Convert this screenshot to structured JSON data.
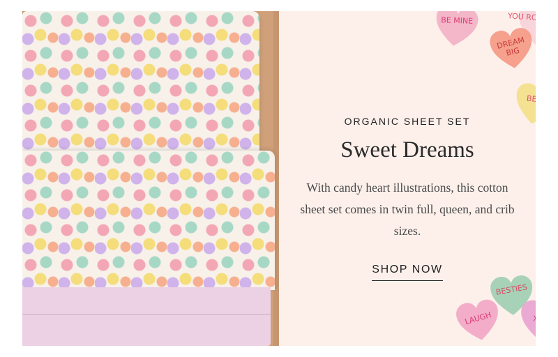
{
  "promo": {
    "kicker": "ORGANIC SHEET SET",
    "title": "Sweet Dreams",
    "description": "With candy heart illustrations, this cotton sheet set comes in twin full, queen, and crib sizes.",
    "cta_label": "SHOP NOW"
  },
  "hearts": [
    {
      "text": "BE MINE",
      "fill": "#f2b2c6",
      "ink": "#e03a78"
    },
    {
      "text": "YOU ROCK",
      "fill": "#f6d2d8",
      "ink": "#e2506e"
    },
    {
      "text": "DREAM BIG",
      "fill": "#f49a86",
      "ink": "#c83b3b"
    },
    {
      "text": "BESTIES",
      "fill": "#f3e089",
      "ink": "#e0507a"
    },
    {
      "text": "BESTIES",
      "fill": "#9fcfb2",
      "ink": "#d84a64"
    },
    {
      "text": "LAUGH",
      "fill": "#f2a7c4",
      "ink": "#d83a70"
    },
    {
      "text": "XOXO",
      "fill": "#e9a4d0",
      "ink": "#d7398b"
    }
  ],
  "colors": {
    "panel_bg": "#fdf0eb",
    "text": "#2b2b2b"
  }
}
